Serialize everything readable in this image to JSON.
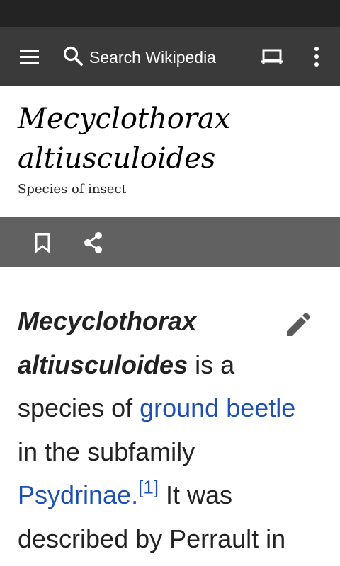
{
  "app_bar": {
    "search_placeholder": "Search Wikipedia",
    "icons": [
      "menu-icon",
      "search-icon",
      "reading-list-icon",
      "overflow-menu-icon"
    ]
  },
  "header": {
    "title": "Mecyclothorax altiusculoides",
    "subtitle": "Species of insect"
  },
  "actions": {
    "icons": [
      "bookmark-icon",
      "share-icon"
    ]
  },
  "article": {
    "bold_title": "Mecyclothorax altiusculoides",
    "text_1": " is a species of ",
    "link_1": "ground beetle",
    "text_2": " in the subfamily ",
    "link_2": "Psydrinae.",
    "ref_1": "[1]",
    "text_3": " It was described by Perrault in",
    "edit_icon": "pencil-icon"
  },
  "colors": {
    "app_bar": "#3a3a3a",
    "status_bar": "#232323",
    "action_bar": "#616161",
    "link": "#1e50b4"
  }
}
